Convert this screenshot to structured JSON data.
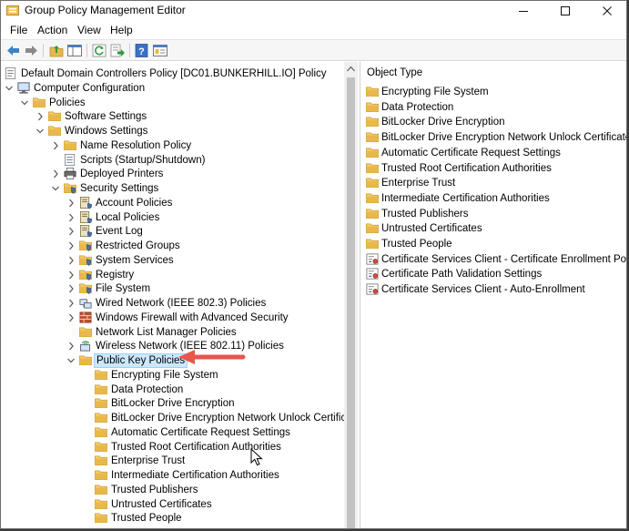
{
  "window": {
    "title": "Group Policy Management Editor"
  },
  "menu": [
    "File",
    "Action",
    "View",
    "Help"
  ],
  "toolbar": {
    "buttons": [
      "back-arrow-icon",
      "forward-arrow-icon",
      "up-folder-icon",
      "show-hide-tree-icon",
      "refresh-icon",
      "export-list-icon",
      "help-icon",
      "properties-icon"
    ]
  },
  "tree": [
    {
      "label": "Default Domain Controllers Policy [DC01.BUNKERHILL.IO] Policy",
      "icon": "policy-icon",
      "depth": 0,
      "expander": "none"
    },
    {
      "label": "Computer Configuration",
      "icon": "computer-icon",
      "depth": 0,
      "expander": "expanded"
    },
    {
      "label": "Policies",
      "icon": "folder-icon",
      "depth": 1,
      "expander": "expanded"
    },
    {
      "label": "Software Settings",
      "icon": "folder-icon",
      "depth": 2,
      "expander": "collapsed"
    },
    {
      "label": "Windows Settings",
      "icon": "folder-icon",
      "depth": 2,
      "expander": "expanded"
    },
    {
      "label": "Name Resolution Policy",
      "icon": "folder-icon",
      "depth": 3,
      "expander": "collapsed"
    },
    {
      "label": "Scripts (Startup/Shutdown)",
      "icon": "script-icon",
      "depth": 3,
      "expander": "none"
    },
    {
      "label": "Deployed Printers",
      "icon": "printer-icon",
      "depth": 3,
      "expander": "collapsed"
    },
    {
      "label": "Security Settings",
      "icon": "security-folder-icon",
      "depth": 3,
      "expander": "expanded"
    },
    {
      "label": "Account Policies",
      "icon": "policy-book-icon",
      "depth": 4,
      "expander": "collapsed"
    },
    {
      "label": "Local Policies",
      "icon": "policy-book-icon",
      "depth": 4,
      "expander": "collapsed"
    },
    {
      "label": "Event Log",
      "icon": "policy-book-icon",
      "depth": 4,
      "expander": "collapsed"
    },
    {
      "label": "Restricted Groups",
      "icon": "security-folder-icon",
      "depth": 4,
      "expander": "collapsed"
    },
    {
      "label": "System Services",
      "icon": "security-folder-icon",
      "depth": 4,
      "expander": "collapsed"
    },
    {
      "label": "Registry",
      "icon": "security-folder-icon",
      "depth": 4,
      "expander": "collapsed"
    },
    {
      "label": "File System",
      "icon": "security-folder-icon",
      "depth": 4,
      "expander": "collapsed"
    },
    {
      "label": "Wired Network (IEEE 802.3) Policies",
      "icon": "network-icon",
      "depth": 4,
      "expander": "collapsed"
    },
    {
      "label": "Windows Firewall with Advanced Security",
      "icon": "firewall-icon",
      "depth": 4,
      "expander": "collapsed"
    },
    {
      "label": "Network List Manager Policies",
      "icon": "folder-icon",
      "depth": 4,
      "expander": "none"
    },
    {
      "label": "Wireless Network (IEEE 802.11) Policies",
      "icon": "wireless-icon",
      "depth": 4,
      "expander": "collapsed"
    },
    {
      "label": "Public Key Policies",
      "icon": "folder-icon",
      "depth": 4,
      "expander": "expanded",
      "selected": true
    },
    {
      "label": "Encrypting File System",
      "icon": "folder-icon",
      "depth": 5,
      "expander": "none"
    },
    {
      "label": "Data Protection",
      "icon": "folder-icon",
      "depth": 5,
      "expander": "none"
    },
    {
      "label": "BitLocker Drive Encryption",
      "icon": "folder-icon",
      "depth": 5,
      "expander": "none"
    },
    {
      "label": "BitLocker Drive Encryption Network Unlock Certificate",
      "icon": "folder-icon",
      "depth": 5,
      "expander": "none"
    },
    {
      "label": "Automatic Certificate Request Settings",
      "icon": "folder-icon",
      "depth": 5,
      "expander": "none"
    },
    {
      "label": "Trusted Root Certification Authorities",
      "icon": "folder-icon",
      "depth": 5,
      "expander": "none"
    },
    {
      "label": "Enterprise Trust",
      "icon": "folder-icon",
      "depth": 5,
      "expander": "none"
    },
    {
      "label": "Intermediate Certification Authorities",
      "icon": "folder-icon",
      "depth": 5,
      "expander": "none"
    },
    {
      "label": "Trusted Publishers",
      "icon": "folder-icon",
      "depth": 5,
      "expander": "none"
    },
    {
      "label": "Untrusted Certificates",
      "icon": "folder-icon",
      "depth": 5,
      "expander": "none"
    },
    {
      "label": "Trusted People",
      "icon": "folder-icon",
      "depth": 5,
      "expander": "none"
    }
  ],
  "list": {
    "header": "Object Type",
    "items": [
      {
        "label": "Encrypting File System",
        "icon": "folder-icon"
      },
      {
        "label": "Data Protection",
        "icon": "folder-icon"
      },
      {
        "label": "BitLocker Drive Encryption",
        "icon": "folder-icon"
      },
      {
        "label": "BitLocker Drive Encryption Network Unlock Certificate",
        "icon": "folder-icon"
      },
      {
        "label": "Automatic Certificate Request Settings",
        "icon": "folder-icon"
      },
      {
        "label": "Trusted Root Certification Authorities",
        "icon": "folder-icon"
      },
      {
        "label": "Enterprise Trust",
        "icon": "folder-icon"
      },
      {
        "label": "Intermediate Certification Authorities",
        "icon": "folder-icon"
      },
      {
        "label": "Trusted Publishers",
        "icon": "folder-icon"
      },
      {
        "label": "Untrusted Certificates",
        "icon": "folder-icon"
      },
      {
        "label": "Trusted People",
        "icon": "folder-icon"
      },
      {
        "label": "Certificate Services Client - Certificate Enrollment Policy",
        "icon": "certificate-settings-icon"
      },
      {
        "label": "Certificate Path Validation Settings",
        "icon": "certificate-settings-icon"
      },
      {
        "label": "Certificate Services Client - Auto-Enrollment",
        "icon": "certificate-settings-icon"
      }
    ]
  },
  "colors": {
    "selection": "#cce8ff",
    "selection_border": "#99d1ff",
    "folder": "#e8b94a",
    "arrow": "#e8564b"
  }
}
